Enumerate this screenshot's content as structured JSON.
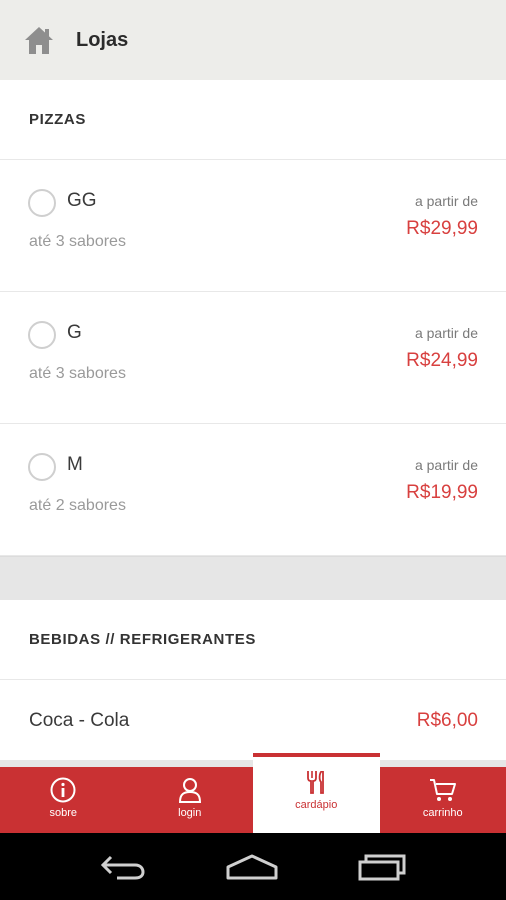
{
  "header": {
    "title": "Lojas",
    "home_icon": "home-icon"
  },
  "sections": {
    "pizzas": {
      "title": "PIZZAS",
      "items": [
        {
          "size": "GG",
          "flavors": "até 3 sabores",
          "from_label": "a partir de",
          "price": "R$29,99"
        },
        {
          "size": "G",
          "flavors": "até 3 sabores",
          "from_label": "a partir de",
          "price": "R$24,99"
        },
        {
          "size": "M",
          "flavors": "até 2 sabores",
          "from_label": "a partir de",
          "price": "R$19,99"
        }
      ]
    },
    "drinks": {
      "title": "BEBIDAS // REFRIGERANTES",
      "items": [
        {
          "name": "Coca - Cola",
          "price": "R$6,00"
        }
      ]
    }
  },
  "bottom_nav": {
    "items": [
      {
        "label": "sobre",
        "icon": "info-icon",
        "active": false
      },
      {
        "label": "login",
        "icon": "user-icon",
        "active": false
      },
      {
        "label": "cardápio",
        "icon": "utensils-icon",
        "active": true
      },
      {
        "label": "carrinho",
        "icon": "cart-icon",
        "active": false
      }
    ]
  },
  "colors": {
    "accent": "#c93133",
    "price": "#d8403f",
    "topbar": "#ededea",
    "background": "#e6e6e6"
  }
}
